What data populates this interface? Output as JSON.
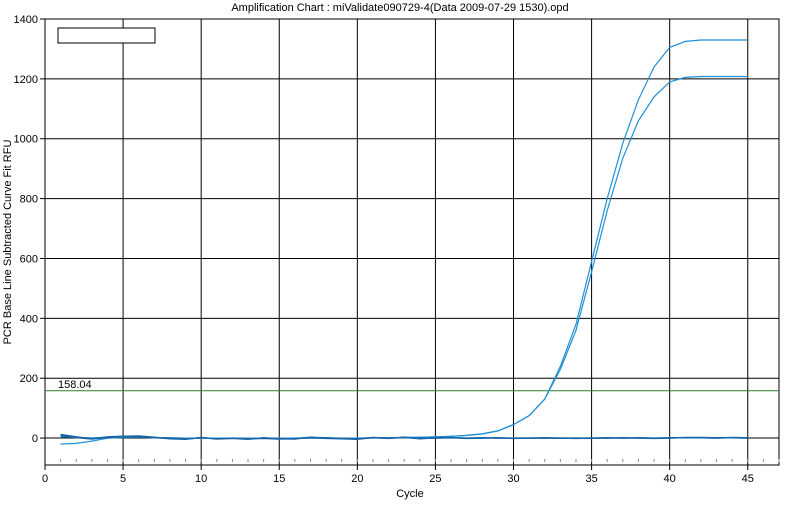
{
  "chart_data": {
    "type": "line",
    "title": "Amplification Chart : miValidate090729-4(Data 2009-07-29 1530).opd",
    "xlabel": "Cycle",
    "ylabel": "PCR Base Line Subtracted Curve Fit RFU",
    "xlim": [
      0,
      47
    ],
    "ylim": [
      -90,
      1400
    ],
    "x_ticks": [
      0,
      5,
      10,
      15,
      20,
      25,
      30,
      35,
      40,
      45
    ],
    "y_ticks": [
      0,
      200,
      400,
      600,
      800,
      1000,
      1200,
      1400
    ],
    "grid": true,
    "legend": {
      "position": "top-left",
      "entries": []
    },
    "threshold": {
      "value": 158.04,
      "label": "158.04",
      "color": "#2e7d32"
    },
    "series_color": "#1f8fd6",
    "flat_series_color": "#1565a8",
    "series": [
      {
        "x": [
          1,
          2,
          3,
          4,
          5,
          6,
          7,
          8,
          9,
          10,
          11,
          12,
          13,
          14,
          15,
          16,
          17,
          18,
          19,
          20,
          21,
          22,
          23,
          24,
          25,
          26,
          27,
          28,
          29,
          30,
          31,
          32,
          33,
          34,
          35,
          36,
          37,
          38,
          39,
          40,
          41,
          42,
          43,
          44,
          45
        ],
        "values": [
          5,
          2,
          1,
          3,
          4,
          3,
          2,
          1,
          0,
          0,
          0,
          0,
          0,
          0,
          0,
          0,
          0,
          0,
          0,
          0,
          1,
          1,
          2,
          3,
          4,
          6,
          9,
          14,
          24,
          45,
          75,
          130,
          240,
          380,
          590,
          800,
          985,
          1130,
          1240,
          1305,
          1325,
          1330,
          1330,
          1330,
          1330
        ]
      },
      {
        "x": [
          1,
          2,
          3,
          4,
          5,
          6,
          7,
          8,
          9,
          10,
          11,
          12,
          13,
          14,
          15,
          16,
          17,
          18,
          19,
          20,
          21,
          22,
          23,
          24,
          25,
          26,
          27,
          28,
          29,
          30,
          31,
          32,
          33,
          34,
          35,
          36,
          37,
          38,
          39,
          40,
          41,
          42,
          43,
          44,
          45
        ],
        "values": [
          -20,
          -18,
          -10,
          0,
          2,
          3,
          2,
          1,
          0,
          0,
          0,
          0,
          0,
          0,
          0,
          0,
          0,
          0,
          0,
          0,
          1,
          1,
          2,
          3,
          4,
          6,
          9,
          14,
          24,
          45,
          75,
          130,
          230,
          360,
          555,
          760,
          935,
          1060,
          1140,
          1190,
          1205,
          1208,
          1208,
          1208,
          1208
        ]
      },
      {
        "x": [
          1,
          2,
          3,
          4,
          5,
          6,
          7,
          8,
          9,
          10,
          11,
          12,
          13,
          14,
          15,
          16,
          17,
          18,
          19,
          20,
          21,
          22,
          23,
          24,
          25,
          26,
          27,
          28,
          29,
          30,
          31,
          32,
          33,
          34,
          35,
          36,
          37,
          38,
          39,
          40,
          41,
          42,
          43,
          44,
          45
        ],
        "values": [
          8,
          2,
          -3,
          4,
          6,
          7,
          3,
          -2,
          -4,
          2,
          -3,
          -1,
          -4,
          1,
          -2,
          -3,
          3,
          -1,
          -2,
          -4,
          2,
          -1,
          3,
          -2,
          1,
          2,
          -1,
          0,
          1,
          -1,
          0,
          0,
          0,
          -1,
          0,
          0,
          1,
          0,
          -1,
          0,
          2,
          1,
          0,
          2,
          1
        ]
      },
      {
        "x": [
          1,
          2,
          3,
          4,
          5,
          6,
          7,
          8,
          9,
          10,
          11,
          12,
          13,
          14,
          15,
          16,
          17,
          18,
          19,
          20,
          21,
          22,
          23,
          24,
          25,
          26,
          27,
          28,
          29,
          30,
          31,
          32,
          33,
          34,
          35,
          36,
          37,
          38,
          39,
          40,
          41,
          42,
          43,
          44,
          45
        ],
        "values": [
          12,
          4,
          -2,
          2,
          5,
          4,
          1,
          0,
          -3,
          1,
          -2,
          0,
          -2,
          -1,
          -3,
          -1,
          2,
          1,
          -1,
          -2,
          1,
          0,
          2,
          -1,
          0,
          1,
          0,
          1,
          0,
          0,
          0,
          1,
          0,
          0,
          0,
          1,
          0,
          1,
          0,
          1,
          1,
          2,
          1,
          1,
          0
        ]
      }
    ]
  }
}
